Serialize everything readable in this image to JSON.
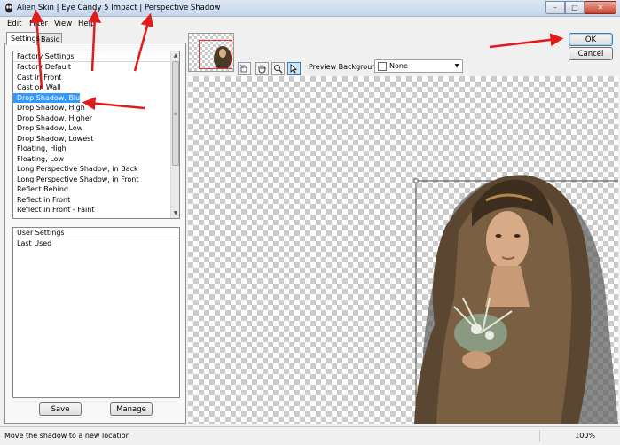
{
  "window": {
    "title": "Alien Skin | Eye Candy 5 Impact | Perspective Shadow",
    "minimize_glyph": "–",
    "maximize_glyph": "□",
    "close_glyph": "✕"
  },
  "menu": {
    "items": [
      "Edit",
      "Filter",
      "View",
      "Help"
    ]
  },
  "tabs": [
    "Settings",
    "Basic"
  ],
  "factory_settings": {
    "header": "Factory Settings",
    "items": [
      "Factory Default",
      "Cast in Front",
      "Cast on Wall",
      "Drop Shadow, Blurry",
      "Drop Shadow, High",
      "Drop Shadow, Higher",
      "Drop Shadow, Low",
      "Drop Shadow, Lowest",
      "Floating, High",
      "Floating, Low",
      "Long Perspective Shadow, in Back",
      "Long Perspective Shadow, in Front",
      "Reflect Behind",
      "Reflect in Front",
      "Reflect in Front - Faint"
    ],
    "selected_index": 3
  },
  "user_settings": {
    "header": "User Settings",
    "items": [
      "Last Used"
    ]
  },
  "buttons": {
    "save": "Save",
    "manage": "Manage",
    "ok": "OK",
    "cancel": "Cancel"
  },
  "preview": {
    "background_label": "Preview Background:",
    "background_value": "None",
    "tools": [
      "hand-cursor-icon",
      "hand-icon",
      "zoom-icon",
      "arrow-cursor-icon"
    ]
  },
  "status": {
    "hint": "Move the shadow to a new location",
    "zoom": "100%"
  },
  "colors": {
    "annotation_arrow": "#e01b1b",
    "selection": "#3399ff"
  }
}
